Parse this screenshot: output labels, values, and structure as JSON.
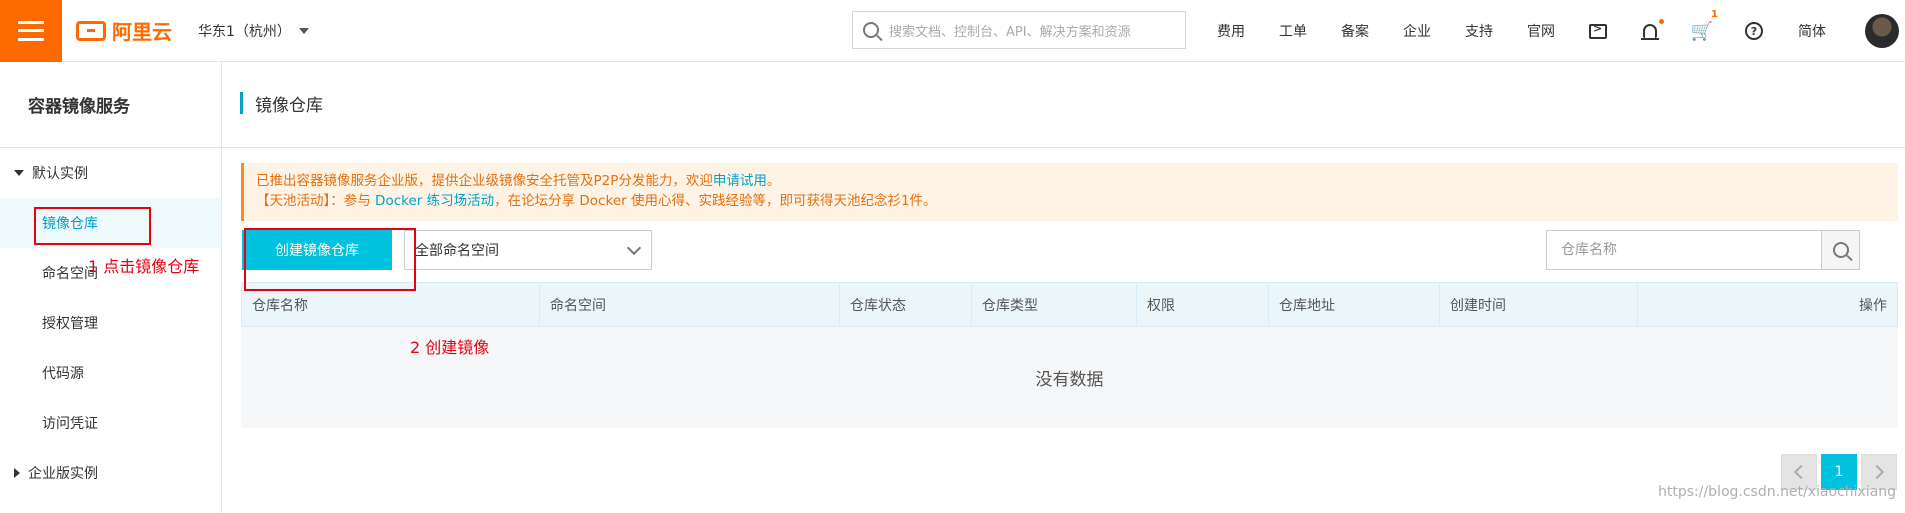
{
  "header": {
    "logo_text": "阿里云",
    "region": "华东1（杭州）",
    "search_placeholder": "搜索文档、控制台、API、解决方案和资源",
    "links": [
      "费用",
      "工单",
      "备案",
      "企业",
      "支持",
      "官网"
    ],
    "cart_count": "1",
    "language": "简体"
  },
  "sidebar": {
    "title": "容器镜像服务",
    "group_default": "默认实例",
    "items": [
      "镜像仓库",
      "命名空间",
      "授权管理",
      "代码源",
      "访问凭证"
    ],
    "group_enterprise": "企业版实例"
  },
  "main": {
    "title": "镜像仓库",
    "notice": {
      "line1_text": "已推出容器镜像服务企业版，提供企业级镜像安全托管及P2P分发能力，欢迎",
      "line1_link": "申请试用",
      "line1_end": "。",
      "line2_prefix": "【天池活动】：参与 ",
      "line2_link": "Docker 练习场活动",
      "line2_suffix": "，在论坛分享 Docker 使用心得、实践经验等，即可获得天池纪念衫1件。"
    },
    "create_button": "创建镜像仓库",
    "namespace_select": "全部命名空间",
    "search_placeholder": "仓库名称",
    "columns": [
      "仓库名称",
      "命名空间",
      "仓库状态",
      "仓库类型",
      "权限",
      "仓库地址",
      "创建时间",
      "操作"
    ],
    "empty_text": "没有数据",
    "pagination": {
      "current_page": "1"
    }
  },
  "annotations": {
    "step1": "1   点击镜像仓库",
    "step2": "2  创建镜像"
  },
  "watermark": "https://blog.csdn.net/xiaochixiang"
}
